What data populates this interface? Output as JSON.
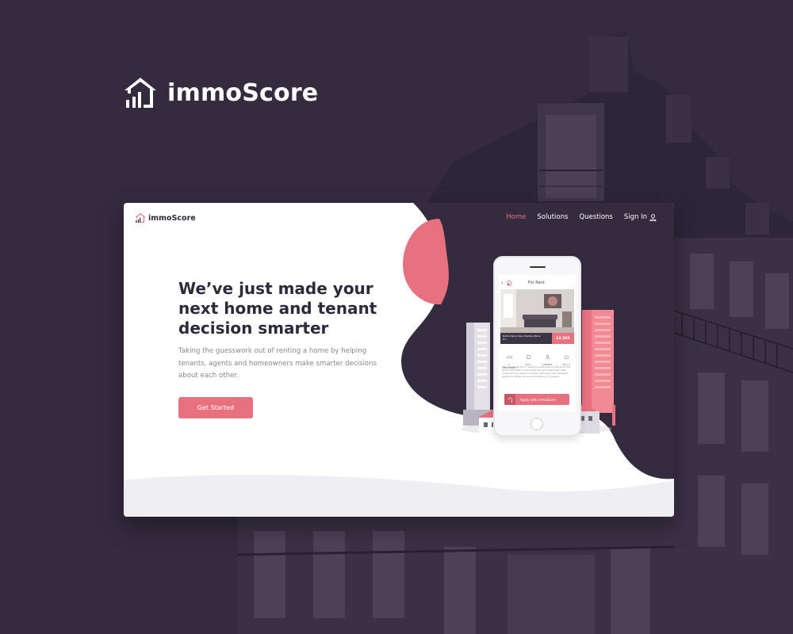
{
  "brand": {
    "name": "immoScore"
  },
  "nav": {
    "logo_text": "immoScore",
    "items": [
      {
        "label": "Home",
        "active": true
      },
      {
        "label": "Solutions",
        "active": false
      },
      {
        "label": "Questions",
        "active": false
      },
      {
        "label": "Sign In",
        "active": false
      }
    ]
  },
  "hero": {
    "title_lines": [
      "We’ve just made your",
      "next home and tenant",
      "decision smarter"
    ],
    "subtitle_lines": [
      "Taking the guesswork out of renting a home by helping",
      "tenants, agents and homeowners make smarter decisions",
      "about each other."
    ],
    "cta_label": "Get Started"
  },
  "phone": {
    "header": "For Rent",
    "address": "Notre Dame Des Champs (Paris 6°)",
    "price": "£2,595",
    "features": [
      "2 BEDROOMS",
      "55m²",
      "2 PEOPLE",
      "Floor 4"
    ],
    "description": "This substantial 55 m² apartment with balcony offered by the owner with 2000, is a furnished version of Saint-Ger ideal. Composed of 2 rooms including 2 bedrooms, this furnished apartment rental can accommodate up to 2 people.",
    "apply_label": "Apply with immoScore"
  },
  "colors": {
    "background": "#342b3f",
    "accent": "#e8717f",
    "dark": "#2f2a3a",
    "card": "#ffffff"
  },
  "icons": [
    "house-logo-icon",
    "user-icon",
    "back-arrow-icon",
    "bed-icon",
    "area-icon",
    "people-icon",
    "floor-icon",
    "share-icon"
  ]
}
